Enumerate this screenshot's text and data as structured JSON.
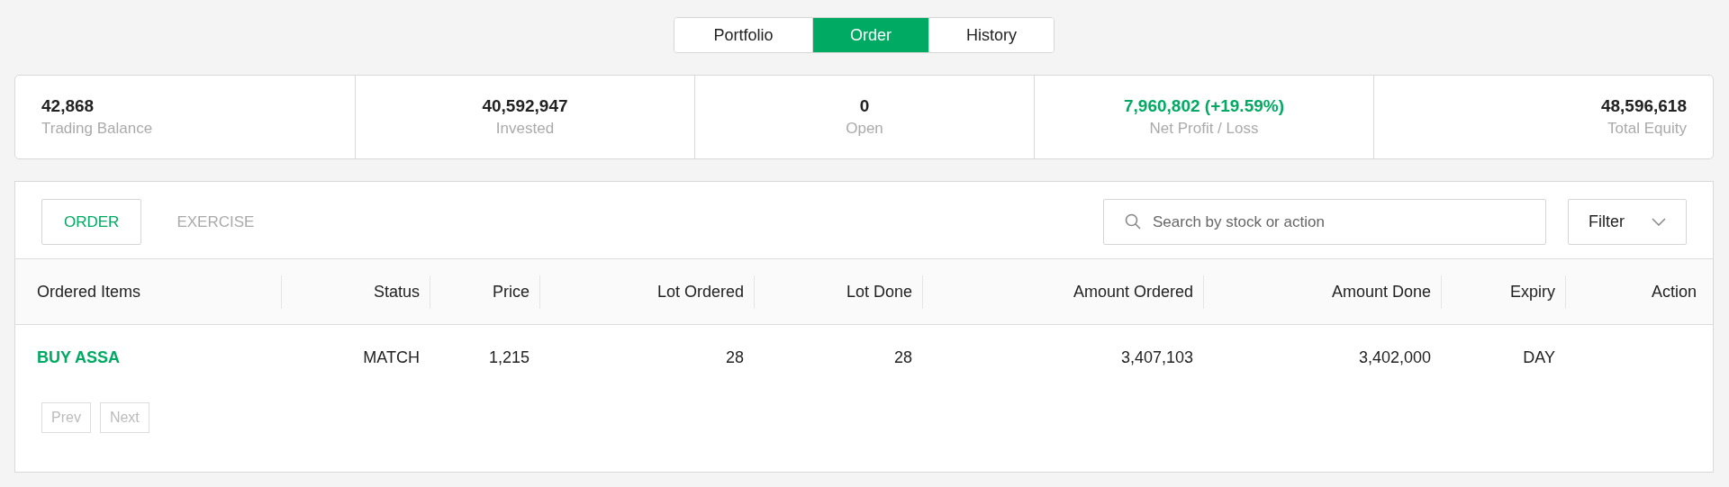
{
  "tabs": [
    {
      "label": "Portfolio",
      "selected": false
    },
    {
      "label": "Order",
      "selected": true
    },
    {
      "label": "History",
      "selected": false
    }
  ],
  "summary": [
    {
      "value": "42,868",
      "label": "Trading Balance",
      "kind": "neutral"
    },
    {
      "value": "40,592,947",
      "label": "Invested",
      "kind": "neutral"
    },
    {
      "value": "0",
      "label": "Open",
      "kind": "neutral"
    },
    {
      "value": "7,960,802 (+19.59%)",
      "label": "Net Profit / Loss",
      "kind": "gain"
    },
    {
      "value": "48,596,618",
      "label": "Total Equity",
      "kind": "neutral"
    }
  ],
  "subtabs": [
    {
      "label": "ORDER",
      "selected": true
    },
    {
      "label": "EXERCISE",
      "selected": false
    }
  ],
  "search": {
    "placeholder": "Search by stock or action"
  },
  "filter": {
    "label": "Filter"
  },
  "table": {
    "columns": [
      "Ordered Items",
      "Status",
      "Price",
      "Lot Ordered",
      "Lot Done",
      "Amount Ordered",
      "Amount Done",
      "Expiry",
      "Action"
    ],
    "rows": [
      [
        "BUY ASSA",
        "MATCH",
        "1,215",
        "28",
        "28",
        "3,407,103",
        "3,402,000",
        "DAY",
        null
      ]
    ]
  },
  "pagination": [
    {
      "label": "Prev",
      "disabled": true
    },
    {
      "label": "Next",
      "disabled": true
    }
  ]
}
